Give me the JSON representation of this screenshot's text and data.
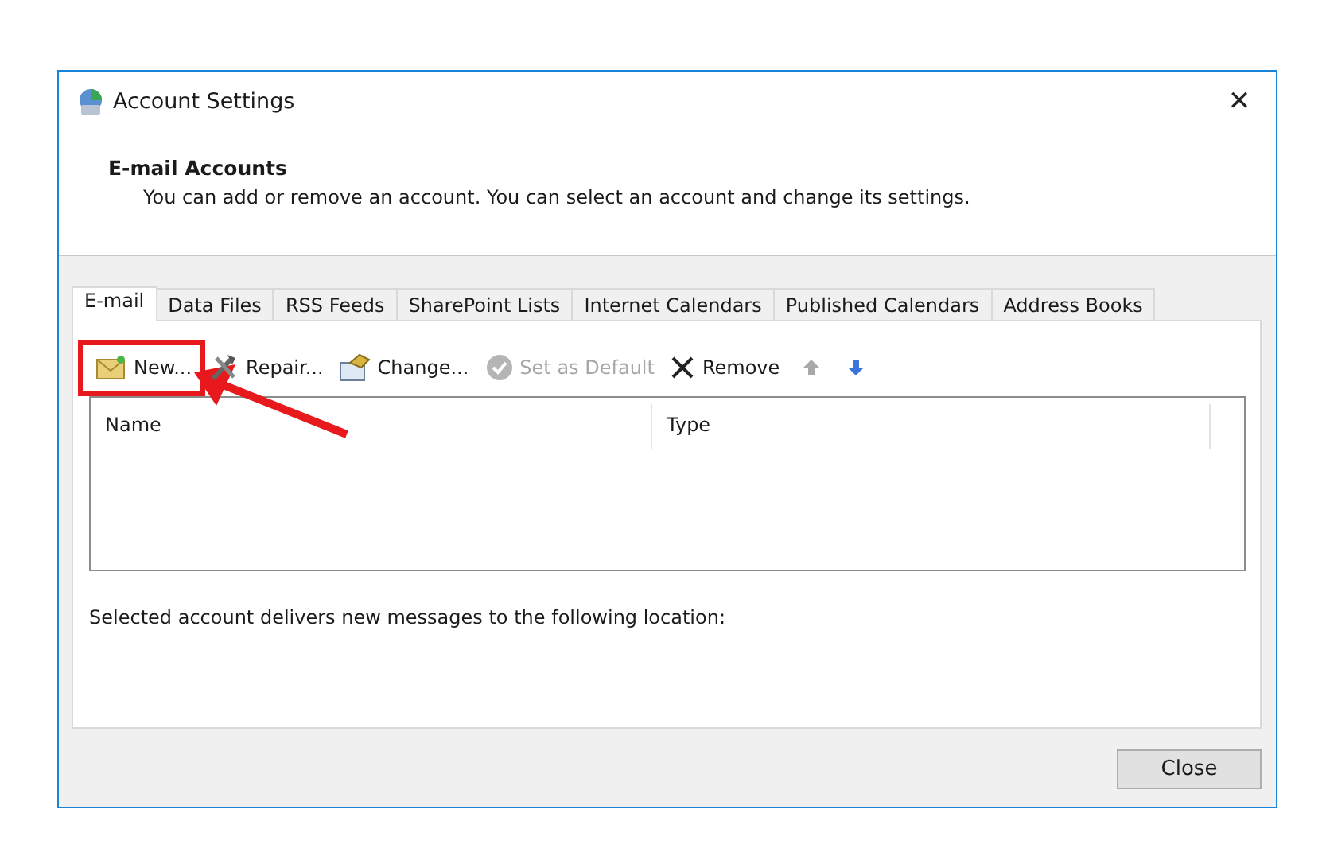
{
  "window": {
    "title": "Account Settings",
    "close_glyph": "✕"
  },
  "header": {
    "title": "E-mail Accounts",
    "description": "You can add or remove an account. You can select an account and change its settings."
  },
  "tabs": [
    {
      "label": "E-mail",
      "selected": true
    },
    {
      "label": "Data Files",
      "selected": false
    },
    {
      "label": "RSS Feeds",
      "selected": false
    },
    {
      "label": "SharePoint Lists",
      "selected": false
    },
    {
      "label": "Internet Calendars",
      "selected": false
    },
    {
      "label": "Published Calendars",
      "selected": false
    },
    {
      "label": "Address Books",
      "selected": false
    }
  ],
  "toolbar": [
    {
      "kind": "new",
      "label": "New...",
      "disabled": false,
      "highlighted": true
    },
    {
      "kind": "repair",
      "label": "Repair...",
      "disabled": false,
      "highlighted": false
    },
    {
      "kind": "change",
      "label": "Change...",
      "disabled": false,
      "highlighted": false
    },
    {
      "kind": "default",
      "label": "Set as Default",
      "disabled": true,
      "highlighted": false
    },
    {
      "kind": "remove",
      "label": "Remove",
      "disabled": false,
      "highlighted": false
    },
    {
      "kind": "up",
      "disabled": true,
      "highlighted": false
    },
    {
      "kind": "down",
      "disabled": false,
      "highlighted": false
    }
  ],
  "table": {
    "columns": [
      "Name",
      "Type"
    ]
  },
  "location_text": "Selected account delivers new messages to the following location:",
  "buttons": [
    "Close"
  ]
}
